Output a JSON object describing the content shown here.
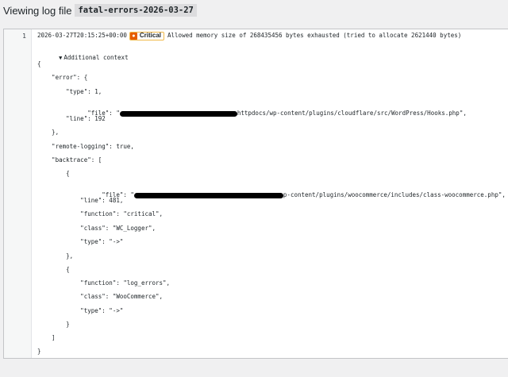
{
  "header": {
    "title_prefix": "Viewing log file",
    "file_name": "fatal-errors-2026-03-27"
  },
  "log": {
    "line_number": "1",
    "entry": {
      "timestamp": "2026-03-27T20:15:25+00:00",
      "level": "Critical",
      "level_color": "#e65c00",
      "message": "Allowed memory size of 268435456 bytes exhausted (tried to allocate 2621440 bytes)"
    },
    "context_toggle": "Additional context",
    "context_lines": [
      "{",
      "    \"error\": {",
      "        \"type\": 1,",
      "        \"file\": \"",
      "        \"line\": 192",
      "    },",
      "    \"remote-logging\": true,",
      "    \"backtrace\": [",
      "        {",
      "            \"file\": \"",
      "            \"line\": 481,",
      "            \"function\": \"critical\",",
      "            \"class\": \"WC_Logger\",",
      "            \"type\": \"->\"",
      "        },",
      "        {",
      "            \"function\": \"log_errors\",",
      "            \"class\": \"WooCommerce\",",
      "            \"type\": \"->\"",
      "        }",
      "    ]",
      "}"
    ],
    "error_file_suffix": "httpdocs/wp-content/plugins/cloudflare/src/WordPress/Hooks.php\",",
    "backtrace_file_suffix": "p-content/plugins/woocommerce/includes/class-woocommerce.php\","
  }
}
